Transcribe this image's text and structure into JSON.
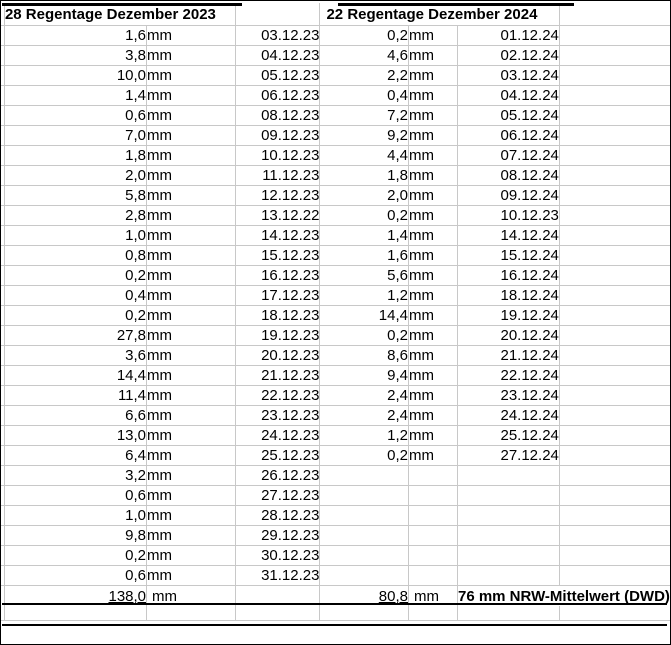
{
  "left": {
    "title": "28 Regentage Dezember 2023",
    "rows": [
      {
        "v": "1,6",
        "u": "mm",
        "d": "03.12.23"
      },
      {
        "v": "3,8",
        "u": "mm",
        "d": "04.12.23"
      },
      {
        "v": "10,0",
        "u": "mm",
        "d": "05.12.23"
      },
      {
        "v": "1,4",
        "u": "mm",
        "d": "06.12.23"
      },
      {
        "v": "0,6",
        "u": "mm",
        "d": "08.12.23"
      },
      {
        "v": "7,0",
        "u": "mm",
        "d": "09.12.23"
      },
      {
        "v": "1,8",
        "u": "mm",
        "d": "10.12.23"
      },
      {
        "v": "2,0",
        "u": "mm",
        "d": "11.12.23"
      },
      {
        "v": "5,8",
        "u": "mm",
        "d": "12.12.23"
      },
      {
        "v": "2,8",
        "u": "mm",
        "d": "13.12.22"
      },
      {
        "v": "1,0",
        "u": "mm",
        "d": "14.12.23"
      },
      {
        "v": "0,8",
        "u": "mm",
        "d": "15.12.23"
      },
      {
        "v": "0,2",
        "u": "mm",
        "d": "16.12.23"
      },
      {
        "v": "0,4",
        "u": "mm",
        "d": "17.12.23"
      },
      {
        "v": "0,2",
        "u": "mm",
        "d": "18.12.23"
      },
      {
        "v": "27,8",
        "u": "mm",
        "d": "19.12.23"
      },
      {
        "v": "3,6",
        "u": "mm",
        "d": "20.12.23"
      },
      {
        "v": "14,4",
        "u": "mm",
        "d": "21.12.23"
      },
      {
        "v": "11,4",
        "u": "mm",
        "d": "22.12.23"
      },
      {
        "v": "6,6",
        "u": "mm",
        "d": "23.12.23"
      },
      {
        "v": "13,0",
        "u": "mm",
        "d": "24.12.23"
      },
      {
        "v": "6,4",
        "u": "mm",
        "d": "25.12.23"
      },
      {
        "v": "3,2",
        "u": "mm",
        "d": "26.12.23"
      },
      {
        "v": "0,6",
        "u": "mm",
        "d": "27.12.23"
      },
      {
        "v": "1,0",
        "u": "mm",
        "d": "28.12.23"
      },
      {
        "v": "9,8",
        "u": "mm",
        "d": "29.12.23"
      },
      {
        "v": "0,2",
        "u": "mm",
        "d": "30.12.23"
      },
      {
        "v": "0,6",
        "u": "mm",
        "d": "31.12.23"
      }
    ],
    "total": "138,0",
    "total_unit": "mm"
  },
  "right": {
    "title": "22 Regentage Dezember 2024",
    "rows": [
      {
        "v": "0,2",
        "u": "mm",
        "d": "01.12.24"
      },
      {
        "v": "4,6",
        "u": "mm",
        "d": "02.12.24"
      },
      {
        "v": "2,2",
        "u": "mm",
        "d": "03.12.24"
      },
      {
        "v": "0,4",
        "u": "mm",
        "d": "04.12.24"
      },
      {
        "v": "7,2",
        "u": "mm",
        "d": "05.12.24"
      },
      {
        "v": "9,2",
        "u": "mm",
        "d": "06.12.24"
      },
      {
        "v": "4,4",
        "u": "mm",
        "d": "07.12.24"
      },
      {
        "v": "1,8",
        "u": "mm",
        "d": "08.12.24"
      },
      {
        "v": "2,0",
        "u": "mm",
        "d": "09.12.24"
      },
      {
        "v": "0,2",
        "u": "mm",
        "d": "10.12.23"
      },
      {
        "v": "1,4",
        "u": "mm",
        "d": "14.12.24"
      },
      {
        "v": "1,6",
        "u": "mm",
        "d": "15.12.24"
      },
      {
        "v": "5,6",
        "u": "mm",
        "d": "16.12.24"
      },
      {
        "v": "1,2",
        "u": "mm",
        "d": "18.12.24"
      },
      {
        "v": "14,4",
        "u": "mm",
        "d": "19.12.24"
      },
      {
        "v": "0,2",
        "u": "mm",
        "d": "20.12.24"
      },
      {
        "v": "8,6",
        "u": "mm",
        "d": "21.12.24"
      },
      {
        "v": "9,4",
        "u": "mm",
        "d": "22.12.24"
      },
      {
        "v": "2,4",
        "u": "mm",
        "d": "23.12.24"
      },
      {
        "v": "2,4",
        "u": "mm",
        "d": "24.12.24"
      },
      {
        "v": "1,2",
        "u": "mm",
        "d": "25.12.24"
      },
      {
        "v": "0,2",
        "u": "mm",
        "d": "27.12.24"
      }
    ],
    "total": "80,8",
    "total_unit": "mm",
    "note": "76 mm NRW-Mittelwert (DWD)"
  },
  "colors": {
    "title": "#0000cc",
    "note": "#ff0000",
    "grid": "#c8c8c8"
  }
}
